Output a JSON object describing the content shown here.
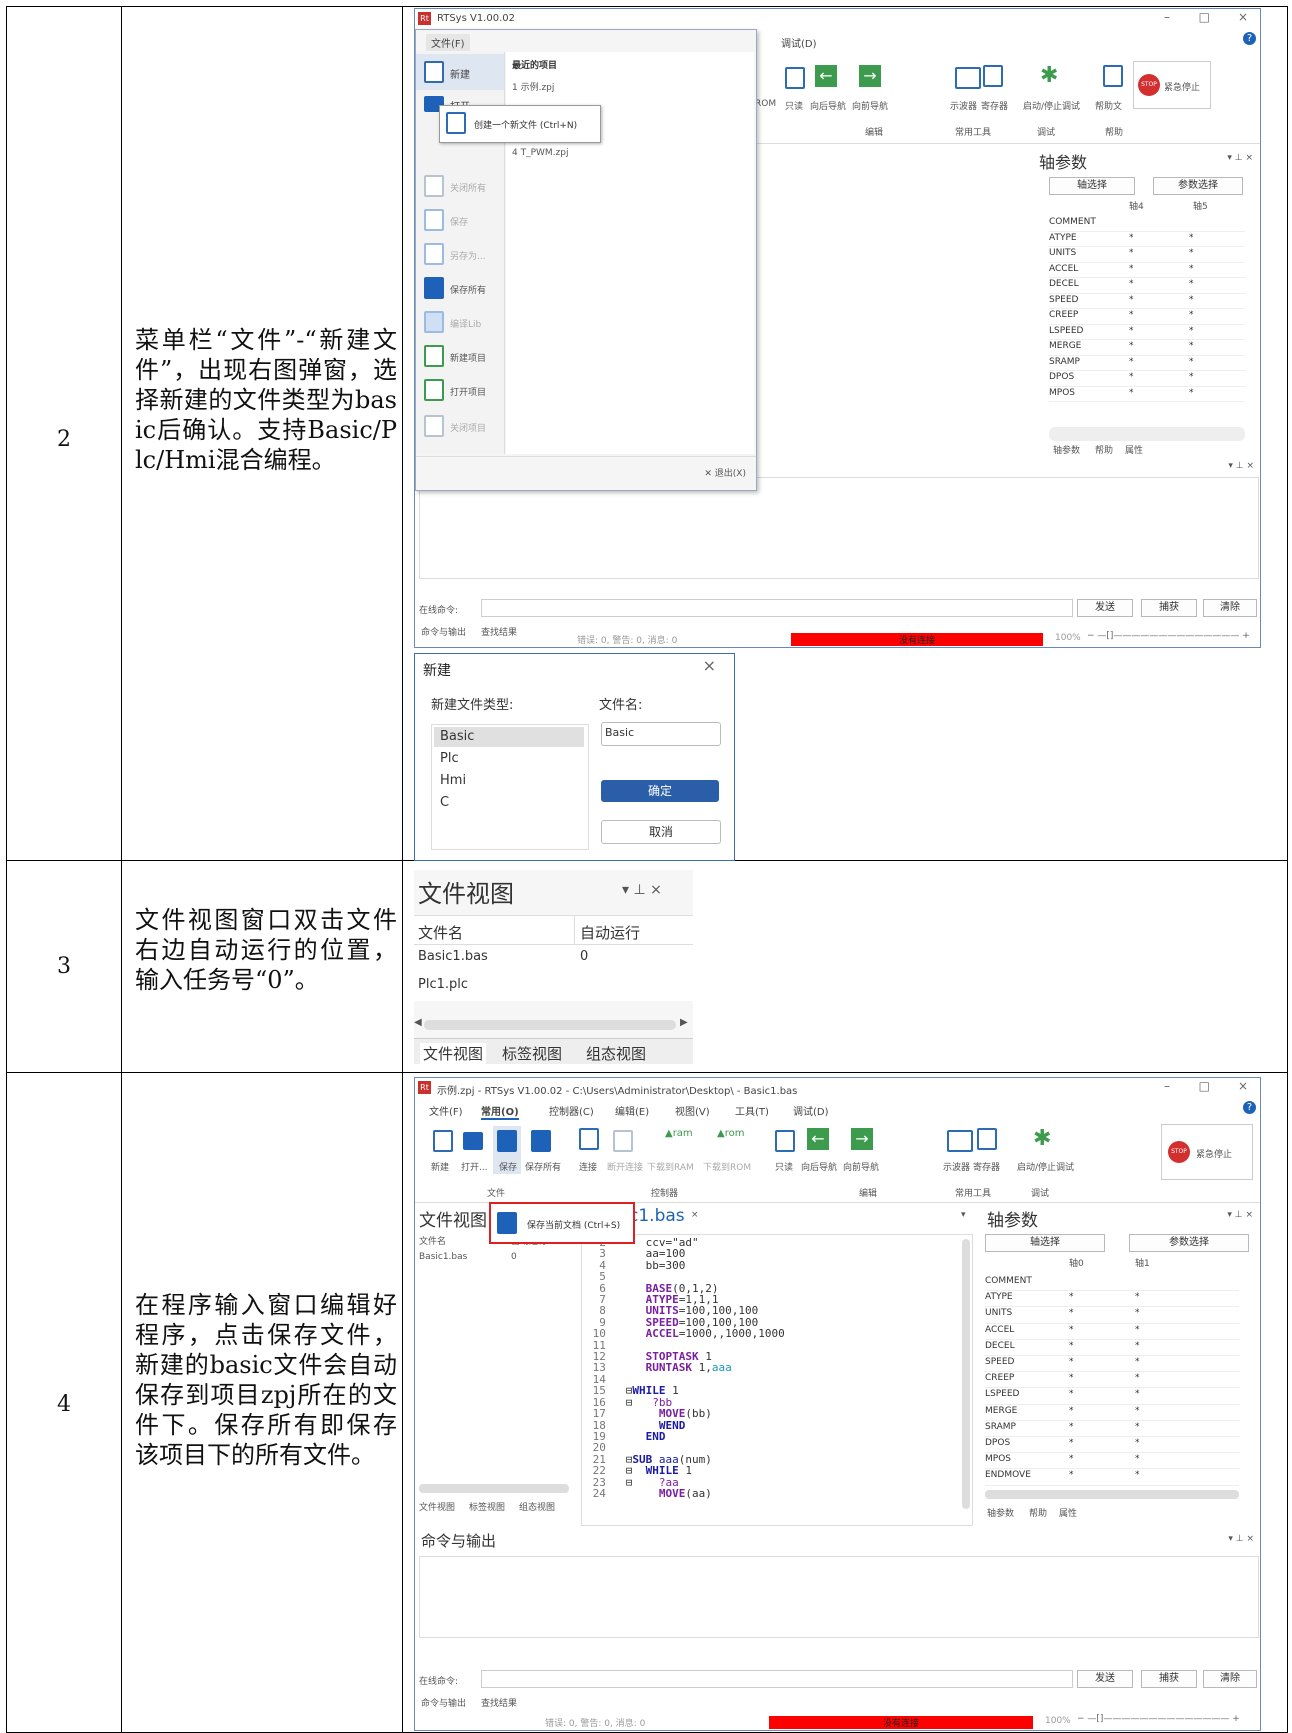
{
  "rows": [
    {
      "num": "2",
      "desc": "菜单栏“文件”-“新建文件”，出现右图弹窗，选择新建的文件类型为basic后确认。支持Basic/Plc/Hmi混合编程。"
    },
    {
      "num": "3",
      "desc": "文件视图窗口双击文件右边自动运行的位置，输入任务号“0”。"
    },
    {
      "num": "4",
      "desc": "在程序输入窗口编辑好程序，点击保存文件，新建的basic文件会自动保存到项目zpj所在的文件下。保存所有即保存该项目下的所有文件。"
    }
  ],
  "shot1": {
    "title": "RTSys V1.00.02",
    "file_tab": "文件(F)",
    "debug_tab": "调试(D)",
    "menu_items": [
      "新建",
      "打开...",
      "",
      "关闭所有",
      "保存",
      "另存为...",
      "保存所有",
      "编译Lib",
      "新建项目",
      "打开项目",
      "关闭项目"
    ],
    "recent_header": "最近的项目",
    "recent": [
      "1 示例.zpj",
      "4 T_PWM.zpj"
    ],
    "tooltip": "创建一个新文件 (Ctrl+N)",
    "exit": "退出(X)",
    "toolbar": [
      "ROM",
      "只读",
      "向后导航",
      "向前导航",
      "示波器",
      "寄存器",
      "启动/停止调试",
      "帮助文",
      "紧急停止"
    ],
    "groups": [
      "编辑",
      "常用工具",
      "调试",
      "帮助"
    ],
    "axis_panel": {
      "title": "轴参数",
      "btn1": "轴选择",
      "btn2": "参数选择",
      "cols": [
        "轴4",
        "轴5"
      ],
      "params": [
        "COMMENT",
        "ATYPE",
        "UNITS",
        "ACCEL",
        "DECEL",
        "SPEED",
        "CREEP",
        "LSPEED",
        "MERGE",
        "SRAMP",
        "DPOS",
        "MPOS"
      ],
      "tabs": [
        "轴参数",
        "帮助",
        "属性"
      ]
    },
    "cmd_label": "在线命令:",
    "send": "发送",
    "capture": "捕获",
    "clear": "清除",
    "out_tabs": [
      "命令与输出",
      "查找结果"
    ],
    "status": "错误: 0, 警告: 0, 消息: 0",
    "noconn": "没有连接",
    "zoom": "100%"
  },
  "dialog": {
    "title": "新建",
    "type_label": "新建文件类型:",
    "name_label": "文件名:",
    "types": [
      "Basic",
      "Plc",
      "Hmi",
      "C"
    ],
    "name_value": "Basic",
    "ok": "确定",
    "cancel": "取消"
  },
  "fileview": {
    "title": "文件视图",
    "col1": "文件名",
    "col2": "自动运行",
    "files": [
      {
        "name": "Basic1.bas",
        "auto": "0"
      },
      {
        "name": "Plc1.plc",
        "auto": ""
      }
    ],
    "tabs": [
      "文件视图",
      "标签视图",
      "组态视图"
    ]
  },
  "shot3": {
    "title": "示例.zpj - RTSys V1.00.02 - C:\\Users\\Administrator\\Desktop\\ - Basic1.bas",
    "menus": [
      "文件(F)",
      "常用(O)",
      "控制器(C)",
      "编辑(E)",
      "视图(V)",
      "工具(T)",
      "调试(D)"
    ],
    "tools": [
      "新建",
      "打开...",
      "保存",
      "保存所有",
      "连接",
      "断开连接",
      "下载到RAM",
      "下载到ROM",
      "只读",
      "向后导航",
      "向前导航",
      "示波器",
      "寄存器",
      "启动/停止调试",
      "紧急停止"
    ],
    "groups": [
      "文件",
      "控制器",
      "编辑",
      "常用工具",
      "调试"
    ],
    "tooltip": "保存当前文档 (Ctrl+S)",
    "fv_title": "文件视图",
    "tab": "c1.bas",
    "fcol1": "文件名",
    "fcol2": "自动运行",
    "file": "Basic1.bas",
    "file_auto": "0",
    "left_tabs": [
      "文件视图",
      "标签视图",
      "组态视图"
    ],
    "axis_title": "轴参数",
    "axis_btn1": "轴选择",
    "axis_btn2": "参数选择",
    "axis_cols": [
      "轴0",
      "轴1"
    ],
    "params": [
      "COMMENT",
      "ATYPE",
      "UNITS",
      "ACCEL",
      "DECEL",
      "SPEED",
      "CREEP",
      "LSPEED",
      "MERGE",
      "SRAMP",
      "DPOS",
      "MPOS",
      "ENDMOVE"
    ],
    "axis_tabs": [
      "轴参数",
      "帮助",
      "属性"
    ],
    "out_title": "命令与输出",
    "cmd_label": "在线命令:",
    "send": "发送",
    "capture": "捕获",
    "clear": "清除",
    "out_tabs": [
      "命令与输出",
      "查找结果"
    ],
    "status": "错误: 0, 警告: 0, 消息: 0",
    "noconn": "没有连接",
    "zoom": "100%"
  }
}
